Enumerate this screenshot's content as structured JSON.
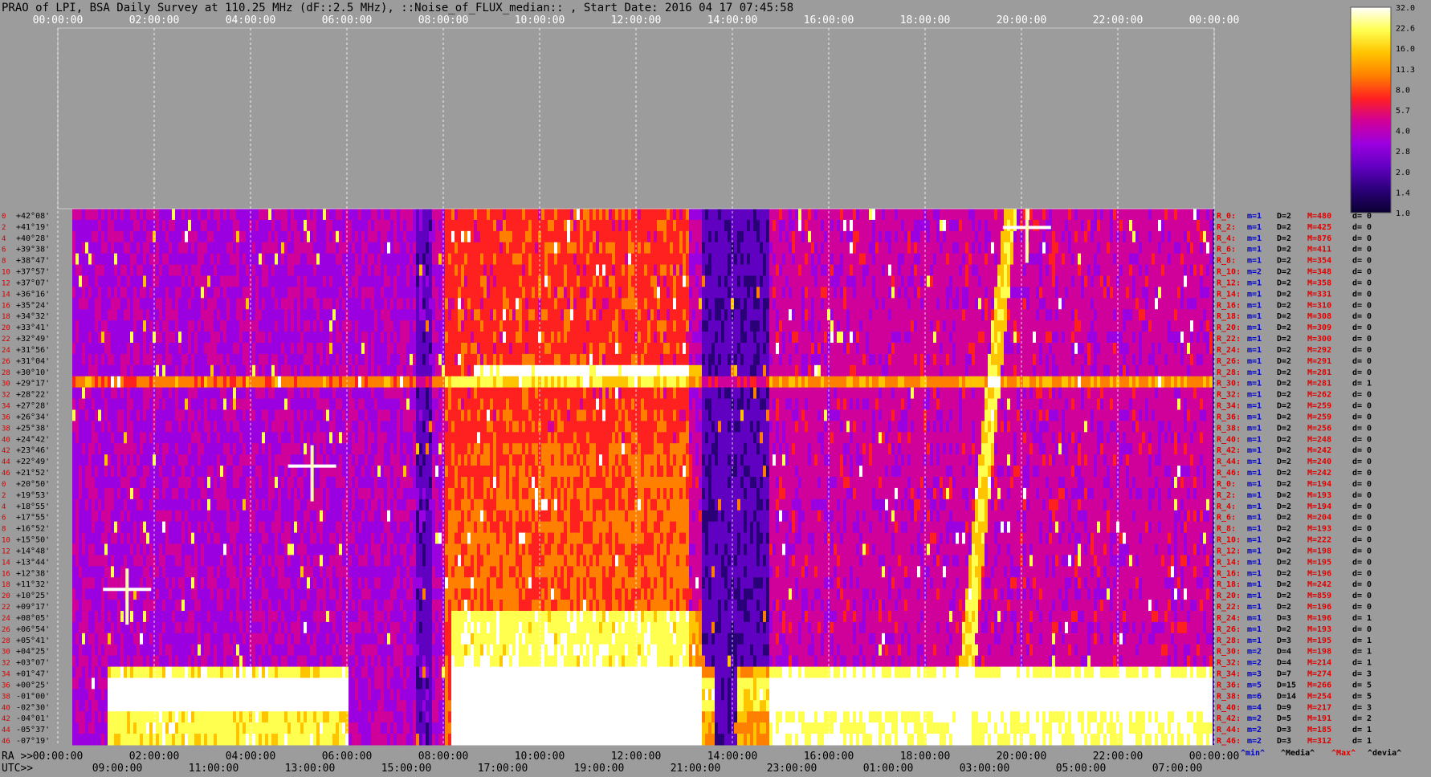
{
  "title": "PRAO of LPI, BSA Daily Survey at 110.25 MHz (dF::2.5 MHz), ::Noise_of_FLUX_median:: , Start Date: 2016 04 17 07:45:58",
  "chart_data": {
    "type": "heatmap",
    "title": "PRAO of LPI, BSA Daily Survey at 110.25 MHz (dF::2.5 MHz), ::Noise_of_FLUX_median:: , Start Date: 2016 04 17 07:45:58",
    "x_top_ticks": [
      "00:00:00",
      "02:00:00",
      "04:00:00",
      "06:00:00",
      "08:00:00",
      "10:00:00",
      "12:00:00",
      "14:00:00",
      "16:00:00",
      "18:00:00",
      "20:00:00",
      "22:00:00",
      "00:00:00"
    ],
    "x_ra_prefix": "RA >>",
    "x_ra_ticks": [
      "00:00:00",
      "02:00:00",
      "04:00:00",
      "06:00:00",
      "08:00:00",
      "10:00:00",
      "12:00:00",
      "14:00:00",
      "16:00:00",
      "18:00:00",
      "20:00:00",
      "22:00:00",
      "00:00:00"
    ],
    "x_utc_prefix": "UTC>>",
    "x_utc_ticks": [
      "09:00:00",
      "11:00:00",
      "13:00:00",
      "15:00:00",
      "17:00:00",
      "19:00:00",
      "21:00:00",
      "23:00:00",
      "01:00:00",
      "03:00:00",
      "05:00:00",
      "07:00:00"
    ],
    "declinations": [
      "+42°08'",
      "+41°19'",
      "+40°28'",
      "+39°38'",
      "+38°47'",
      "+37°57'",
      "+37°07'",
      "+36°16'",
      "+35°24'",
      "+34°32'",
      "+33°41'",
      "+32°49'",
      "+31°56'",
      "+31°04'",
      "+30°10'",
      "+29°17'",
      "+28°22'",
      "+27°28'",
      "+26°34'",
      "+25°38'",
      "+24°42'",
      "+23°46'",
      "+22°49'",
      "+21°52'",
      "+20°50'",
      "+19°53'",
      "+18°55'",
      "+17°55'",
      "+16°52'",
      "+15°50'",
      "+14°48'",
      "+13°44'",
      "+12°38'",
      "+11°32'",
      "+10°25'",
      "+09°17'",
      "+08°05'",
      "+06°54'",
      "+05°41'",
      "+04°25'",
      "+03°07'",
      "+01°47'",
      "+00°25'",
      "-01°00'",
      "-02°30'",
      "-04°01'",
      "-05°37'",
      "-07°19'"
    ],
    "row_numbers": [
      "0",
      "2",
      "4",
      "6",
      "8",
      "10",
      "12",
      "14",
      "16",
      "18",
      "20",
      "22",
      "24",
      "26",
      "28",
      "30",
      "32",
      "34",
      "36",
      "38",
      "40",
      "42",
      "44",
      "46",
      "0",
      "2",
      "4",
      "6",
      "8",
      "10",
      "12",
      "14",
      "16",
      "18",
      "20",
      "22",
      "24",
      "26",
      "28",
      "30",
      "32",
      "34",
      "36",
      "38",
      "40",
      "42",
      "44",
      "46"
    ],
    "row_stats": [
      {
        "r": "R_0:",
        "m": "m=1",
        "D": "D=2",
        "M": "M=480",
        "d": "d= 0"
      },
      {
        "r": "R_2:",
        "m": "m=1",
        "D": "D=2",
        "M": "M=425",
        "d": "d= 0"
      },
      {
        "r": "R_4:",
        "m": "m=1",
        "D": "D=2",
        "M": "M=876",
        "d": "d= 0"
      },
      {
        "r": "R_6:",
        "m": "m=1",
        "D": "D=2",
        "M": "M=411",
        "d": "d= 0"
      },
      {
        "r": "R_8:",
        "m": "m=1",
        "D": "D=2",
        "M": "M=354",
        "d": "d= 0"
      },
      {
        "r": "R_10:",
        "m": "m=2",
        "D": "D=2",
        "M": "M=348",
        "d": "d= 0"
      },
      {
        "r": "R_12:",
        "m": "m=1",
        "D": "D=2",
        "M": "M=358",
        "d": "d= 0"
      },
      {
        "r": "R_14:",
        "m": "m=1",
        "D": "D=2",
        "M": "M=331",
        "d": "d= 0"
      },
      {
        "r": "R_16:",
        "m": "m=1",
        "D": "D=2",
        "M": "M=310",
        "d": "d= 0"
      },
      {
        "r": "R_18:",
        "m": "m=1",
        "D": "D=2",
        "M": "M=308",
        "d": "d= 0"
      },
      {
        "r": "R_20:",
        "m": "m=1",
        "D": "D=2",
        "M": "M=309",
        "d": "d= 0"
      },
      {
        "r": "R_22:",
        "m": "m=1",
        "D": "D=2",
        "M": "M=300",
        "d": "d= 0"
      },
      {
        "r": "R_24:",
        "m": "m=1",
        "D": "D=2",
        "M": "M=292",
        "d": "d= 0"
      },
      {
        "r": "R_26:",
        "m": "m=1",
        "D": "D=2",
        "M": "M=291",
        "d": "d= 0"
      },
      {
        "r": "R_28:",
        "m": "m=1",
        "D": "D=2",
        "M": "M=281",
        "d": "d= 0"
      },
      {
        "r": "R_30:",
        "m": "m=1",
        "D": "D=2",
        "M": "M=281",
        "d": "d= 1"
      },
      {
        "r": "R_32:",
        "m": "m=1",
        "D": "D=2",
        "M": "M=262",
        "d": "d= 0"
      },
      {
        "r": "R_34:",
        "m": "m=1",
        "D": "D=2",
        "M": "M=259",
        "d": "d= 0"
      },
      {
        "r": "R_36:",
        "m": "m=1",
        "D": "D=2",
        "M": "M=259",
        "d": "d= 0"
      },
      {
        "r": "R_38:",
        "m": "m=1",
        "D": "D=2",
        "M": "M=256",
        "d": "d= 0"
      },
      {
        "r": "R_40:",
        "m": "m=1",
        "D": "D=2",
        "M": "M=248",
        "d": "d= 0"
      },
      {
        "r": "R_42:",
        "m": "m=1",
        "D": "D=2",
        "M": "M=242",
        "d": "d= 0"
      },
      {
        "r": "R_44:",
        "m": "m=1",
        "D": "D=2",
        "M": "M=240",
        "d": "d= 0"
      },
      {
        "r": "R_46:",
        "m": "m=1",
        "D": "D=2",
        "M": "M=242",
        "d": "d= 0"
      },
      {
        "r": "R_0:",
        "m": "m=1",
        "D": "D=2",
        "M": "M=194",
        "d": "d= 0"
      },
      {
        "r": "R_2:",
        "m": "m=1",
        "D": "D=2",
        "M": "M=193",
        "d": "d= 0"
      },
      {
        "r": "R_4:",
        "m": "m=1",
        "D": "D=2",
        "M": "M=194",
        "d": "d= 0"
      },
      {
        "r": "R_6:",
        "m": "m=1",
        "D": "D=2",
        "M": "M=204",
        "d": "d= 0"
      },
      {
        "r": "R_8:",
        "m": "m=1",
        "D": "D=2",
        "M": "M=193",
        "d": "d= 0"
      },
      {
        "r": "R_10:",
        "m": "m=1",
        "D": "D=2",
        "M": "M=222",
        "d": "d= 0"
      },
      {
        "r": "R_12:",
        "m": "m=1",
        "D": "D=2",
        "M": "M=198",
        "d": "d= 0"
      },
      {
        "r": "R_14:",
        "m": "m=1",
        "D": "D=2",
        "M": "M=195",
        "d": "d= 0"
      },
      {
        "r": "R_16:",
        "m": "m=1",
        "D": "D=2",
        "M": "M=196",
        "d": "d= 0"
      },
      {
        "r": "R_18:",
        "m": "m=1",
        "D": "D=2",
        "M": "M=242",
        "d": "d= 0"
      },
      {
        "r": "R_20:",
        "m": "m=1",
        "D": "D=2",
        "M": "M=859",
        "d": "d= 0"
      },
      {
        "r": "R_22:",
        "m": "m=1",
        "D": "D=2",
        "M": "M=196",
        "d": "d= 0"
      },
      {
        "r": "R_24:",
        "m": "m=1",
        "D": "D=3",
        "M": "M=196",
        "d": "d= 1"
      },
      {
        "r": "R_26:",
        "m": "m=1",
        "D": "D=2",
        "M": "M=193",
        "d": "d= 0"
      },
      {
        "r": "R_28:",
        "m": "m=1",
        "D": "D=3",
        "M": "M=195",
        "d": "d= 1"
      },
      {
        "r": "R_30:",
        "m": "m=2",
        "D": "D=4",
        "M": "M=198",
        "d": "d= 1"
      },
      {
        "r": "R_32:",
        "m": "m=2",
        "D": "D=4",
        "M": "M=214",
        "d": "d= 1"
      },
      {
        "r": "R_34:",
        "m": "m=3",
        "D": "D=7",
        "M": "M=274",
        "d": "d= 3"
      },
      {
        "r": "R_36:",
        "m": "m=5",
        "D": "D=15",
        "M": "M=266",
        "d": "d= 5"
      },
      {
        "r": "R_38:",
        "m": "m=6",
        "D": "D=14",
        "M": "M=254",
        "d": "d= 5"
      },
      {
        "r": "R_40:",
        "m": "m=4",
        "D": "D=9",
        "M": "M=217",
        "d": "d= 3"
      },
      {
        "r": "R_42:",
        "m": "m=2",
        "D": "D=5",
        "M": "M=191",
        "d": "d= 2"
      },
      {
        "r": "R_44:",
        "m": "m=2",
        "D": "D=3",
        "M": "M=185",
        "d": "d= 1"
      },
      {
        "r": "R_46:",
        "m": "m=2",
        "D": "D=3",
        "M": "M=312",
        "d": "d= 1"
      }
    ],
    "stat_headers": [
      "^min^",
      "^Media^",
      "^Max^",
      "^devia^"
    ],
    "colorbar": {
      "ticks": [
        "32.0",
        "22.6",
        "16.0",
        "11.3",
        "8.0",
        "5.7",
        "4.0",
        "2.8",
        "2.0",
        "1.4",
        "1.0"
      ],
      "colors": [
        "#ffffff",
        "#ffff50",
        "#ffc400",
        "#ff8000",
        "#ff2020",
        "#d0009a",
        "#9a00e0",
        "#6000c0",
        "#2a0078",
        "#0a0030"
      ]
    },
    "colors": {
      "background": "#9c9c9c",
      "stat_m": "#0000c0",
      "stat_D": "#000000",
      "stat_M": "#e00000",
      "stat_d": "#000000",
      "row_label": "#d00000"
    }
  }
}
